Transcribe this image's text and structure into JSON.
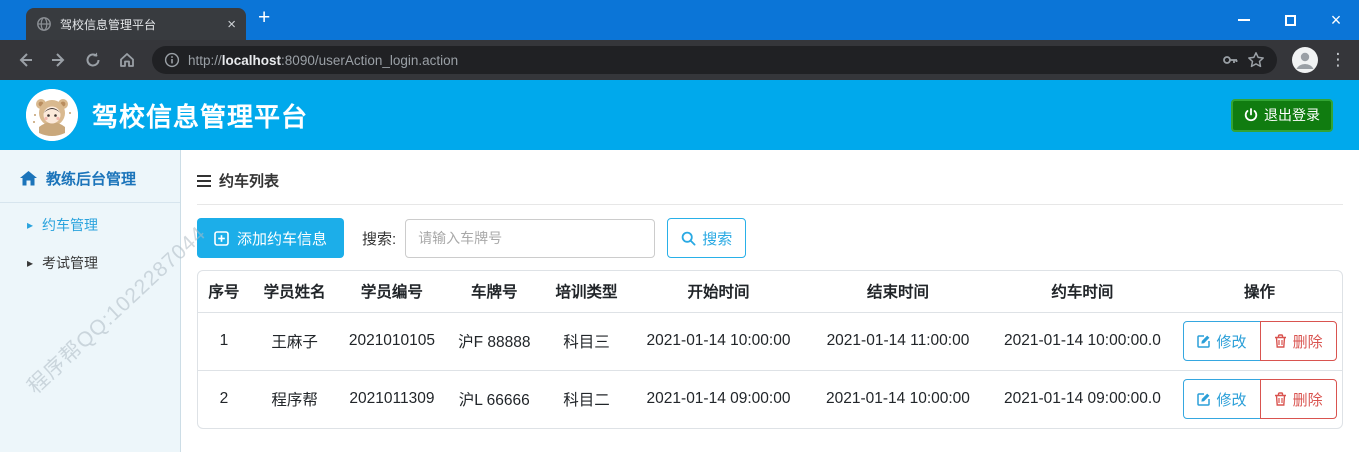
{
  "browser": {
    "tab_title": "驾校信息管理平台",
    "url": {
      "protocol": "http://",
      "host": "localhost",
      "rest": ":8090/userAction_login.action"
    }
  },
  "icons": {
    "tab_close": "×",
    "new_tab": "+",
    "window_close": "×",
    "menu_dots": "⋮",
    "caret": "▸"
  },
  "header": {
    "title": "驾校信息管理平台",
    "logout_label": "退出登录"
  },
  "sidebar": {
    "section_title": "教练后台管理",
    "items": [
      {
        "label": "约车管理",
        "active": true
      },
      {
        "label": "考试管理",
        "active": false
      }
    ],
    "watermark": "程序帮QQ:1022287044"
  },
  "main": {
    "panel_title": "约车列表",
    "add_button_label": "添加约车信息",
    "search_label": "搜索:",
    "search_placeholder": "请输入车牌号",
    "search_button_label": "搜索",
    "table": {
      "headers": [
        "序号",
        "学员姓名",
        "学员编号",
        "车牌号",
        "培训类型",
        "开始时间",
        "结束时间",
        "约车时间",
        "操作"
      ],
      "rows": [
        {
          "seq": "1",
          "name": "王麻子",
          "student_id": "2021010105",
          "plate": "沪F 88888",
          "type": "科目三",
          "start": "2021-01-14 10:00:00",
          "end": "2021-01-14 11:00:00",
          "booked": "2021-01-14 10:00:00.0"
        },
        {
          "seq": "2",
          "name": "程序帮",
          "student_id": "2021011309",
          "plate": "沪L 66666",
          "type": "科目二",
          "start": "2021-01-14 09:00:00",
          "end": "2021-01-14 10:00:00",
          "booked": "2021-01-14 09:00:00.0"
        }
      ],
      "edit_label": "修改",
      "delete_label": "删除"
    }
  },
  "colors": {
    "topbar_blue": "#0b75d7",
    "chrome_dark": "#35363a",
    "urlfield_dark": "#202124",
    "header_blue": "#00a9ec",
    "accent_blue": "#29b0e8",
    "logout_green": "#107c10",
    "sidebar_bg": "#edf6fa",
    "sidebar_title_blue": "#1b74ba",
    "sidebar_active_blue": "#2aa3dd",
    "edit_blue": "#2b9fd8",
    "delete_red": "#d9534f"
  }
}
